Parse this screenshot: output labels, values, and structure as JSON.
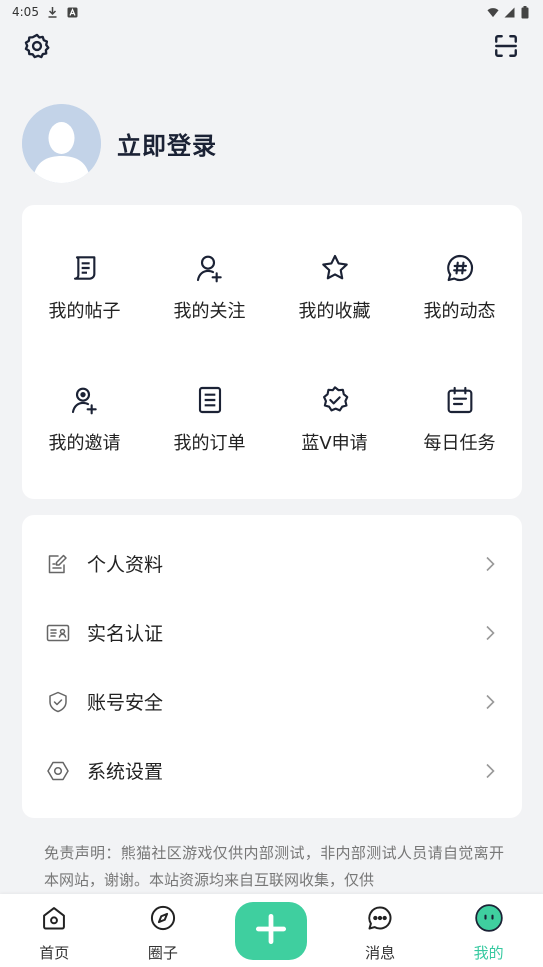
{
  "status_bar": {
    "time": "4:05",
    "icons": [
      "download-icon",
      "a-badge-icon",
      "wifi-icon",
      "signal-icon",
      "battery-icon"
    ]
  },
  "top_bar": {
    "left_icon": "gear-icon",
    "right_icon": "scan-icon"
  },
  "profile": {
    "login_label": "立即登录",
    "avatar_icon": "default-avatar-icon"
  },
  "features": [
    {
      "label": "我的帖子",
      "icon": "posts-icon"
    },
    {
      "label": "我的关注",
      "icon": "follow-user-icon"
    },
    {
      "label": "我的收藏",
      "icon": "star-icon"
    },
    {
      "label": "我的动态",
      "icon": "hashtag-bubble-icon"
    },
    {
      "label": "我的邀请",
      "icon": "invite-user-icon"
    },
    {
      "label": "我的订单",
      "icon": "order-icon"
    },
    {
      "label": "蓝V申请",
      "icon": "verified-badge-icon"
    },
    {
      "label": "每日任务",
      "icon": "calendar-icon"
    }
  ],
  "settings": [
    {
      "label": "个人资料",
      "icon": "edit-doc-icon"
    },
    {
      "label": "实名认证",
      "icon": "id-card-icon"
    },
    {
      "label": "账号安全",
      "icon": "shield-check-icon"
    },
    {
      "label": "系统设置",
      "icon": "hex-settings-icon"
    }
  ],
  "disclaimer": "免责声明：熊猫社区游戏仅供内部测试，非内部测试人员请自觉离开本网站，谢谢。本站资源均来自互联网收集，仅供",
  "tabs": [
    {
      "label": "首页",
      "icon": "home-icon"
    },
    {
      "label": "圈子",
      "icon": "compass-icon"
    },
    {
      "label": "",
      "icon": "plus-icon"
    },
    {
      "label": "消息",
      "icon": "chat-bubble-icon"
    },
    {
      "label": "我的",
      "icon": "face-icon",
      "active": true
    }
  ],
  "colors": {
    "accent": "#3fcf9f",
    "active_tab": "#36c9a0",
    "background": "#f2f3f5",
    "icon_dark": "#1b2235"
  }
}
